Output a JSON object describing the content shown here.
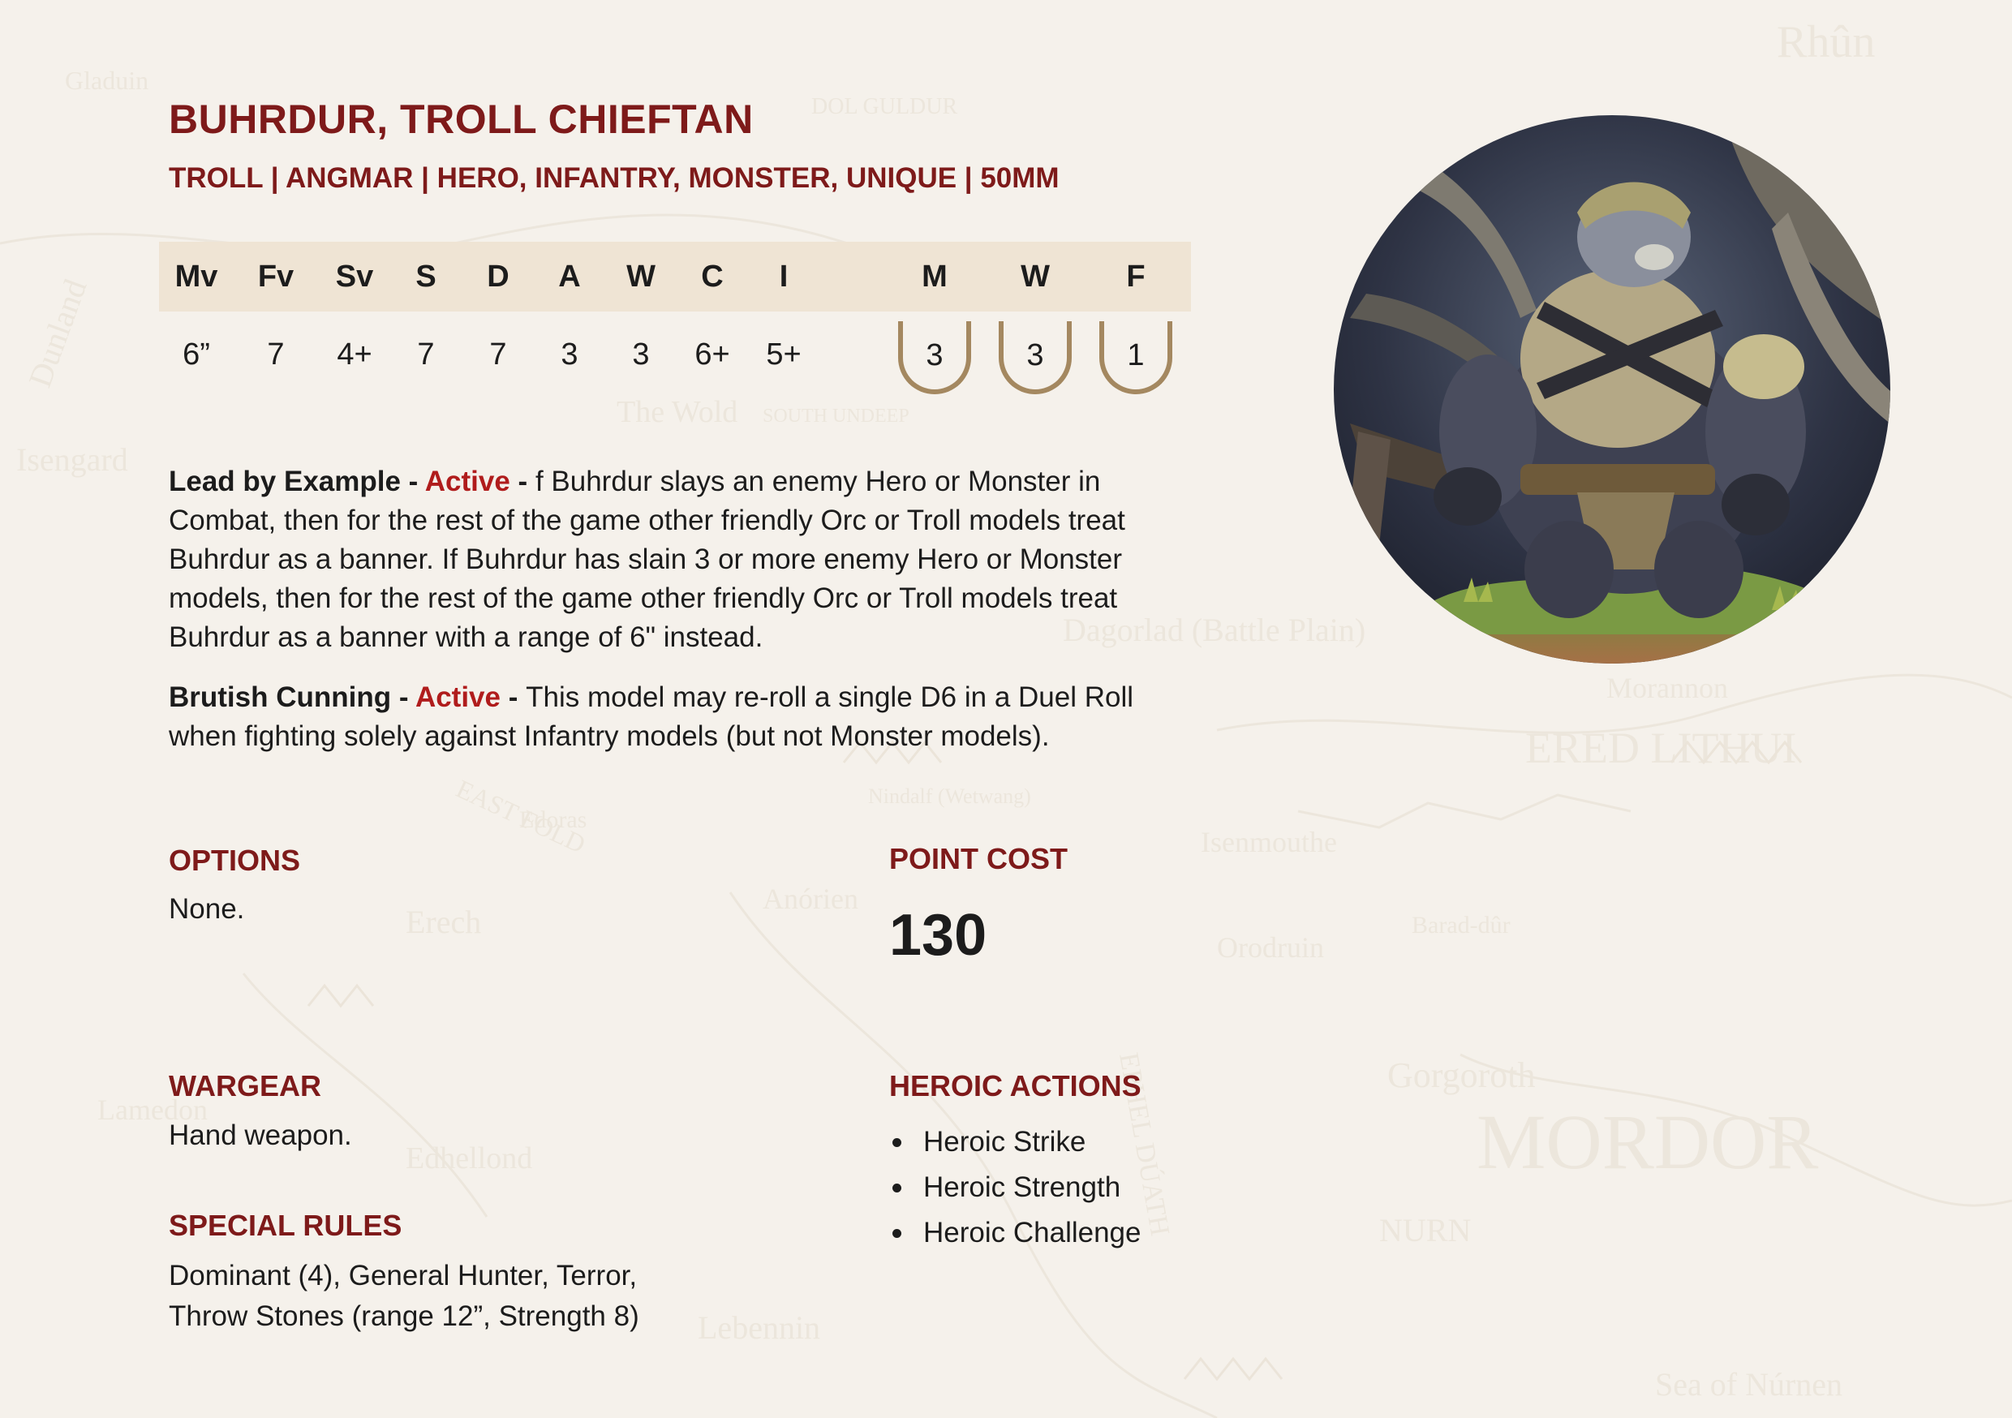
{
  "unit": {
    "name": "BUHRDUR, TROLL CHIEFTAN",
    "keywords": "TROLL | ANGMAR | HERO, INFANTRY, MONSTER, UNIQUE | 50MM"
  },
  "stats": {
    "headers": [
      "Mv",
      "Fv",
      "Sv",
      "S",
      "D",
      "A",
      "W",
      "C",
      "I"
    ],
    "values": [
      "6”",
      "7",
      "4+",
      "7",
      "7",
      "3",
      "3",
      "6+",
      "5+"
    ],
    "hero_headers": [
      "M",
      "W",
      "F"
    ],
    "hero_values": [
      "3",
      "3",
      "1"
    ]
  },
  "abilities": [
    {
      "name": "Lead by Example",
      "sep": " - ",
      "type": "Active",
      "sep2": " - ",
      "text": "f Buhrdur slays an enemy Hero or Monster in Combat, then for the rest of the game other friendly Orc or Troll models treat Buhrdur as a banner. If Buhrdur has slain 3 or more enemy Hero or Monster models, then for the rest of the game other friendly Orc or Troll models treat Buhrdur as a banner with a range of 6\" instead."
    },
    {
      "name": "Brutish Cunning",
      "sep": " - ",
      "type": "Active",
      "sep2": " - ",
      "text": "This model may re-roll a single D6 in a Duel Roll when fighting solely against Infantry models (but not Monster models)."
    }
  ],
  "options": {
    "heading": "OPTIONS",
    "text": "None."
  },
  "point_cost": {
    "heading": "POINT COST",
    "value": "130"
  },
  "wargear": {
    "heading": "WARGEAR",
    "text": "Hand weapon."
  },
  "special_rules": {
    "heading": "SPECIAL RULES",
    "line1": "Dominant (4), General Hunter, Terror,",
    "line2": "Throw Stones (range 12”, Strength 8)"
  },
  "heroic_actions": {
    "heading": "HEROIC ACTIONS",
    "items": [
      "Heroic Strike",
      "Heroic Strength",
      "Heroic Challenge"
    ]
  },
  "map_labels": [
    "Rhûn",
    "Gladuin",
    "DOL GULDUR",
    "Dunland",
    "Isengard",
    "The Wold",
    "SOUTH UNDEEP",
    "Dagorlad (Battle Plain)",
    "EAST FOLD",
    "Edoras",
    "ERED LITHUI",
    "Nindalf (Wetwang)",
    "Anórien",
    "Erech",
    "Isenmouthe",
    "Barad-dûr",
    "Orodruin",
    "Lamedon",
    "Gorgoroth",
    "MORDOR",
    "Edhellond",
    "NURN",
    "Lebennin",
    "Sea of Núrnen",
    "Morannon",
    "EPHEL DÚATH"
  ],
  "colors": {
    "accent": "#7e1a1a",
    "active": "#b01c1c",
    "stat_bar": "#efe4d4",
    "shield": "#a48860",
    "background": "#f5f1eb"
  },
  "image": {
    "subject": "painted troll chieftain miniature",
    "icon": "portrait-image"
  }
}
